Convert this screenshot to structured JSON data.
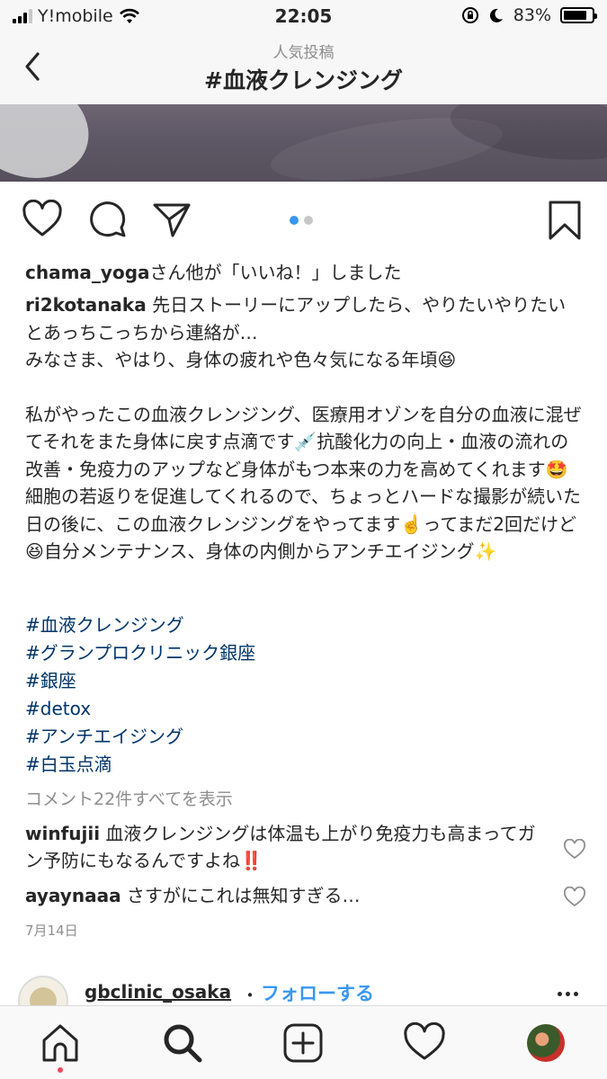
{
  "status_bar": {
    "carrier": "Y!mobile",
    "time": "22:05",
    "battery": "83%",
    "battery_level": 0.83,
    "icons": [
      "signal-icon",
      "wifi-icon",
      "orientation-lock-icon",
      "moon-icon",
      "battery-icon"
    ]
  },
  "nav": {
    "subtitle": "人気投稿",
    "title": "#血液クレンジング",
    "back_icon": "chevron-left-icon"
  },
  "post": {
    "carousel_count": 2,
    "carousel_active": 1,
    "likes_user": "chama_yoga",
    "likes_suffix": "さん他が「いいね！」しました",
    "caption_user": "ri2kotanaka",
    "caption_line1": " 先日ストーリーにアップしたら、やりたいやりたいとあっちこっちから連絡が…",
    "caption_line2": "みなさま、やはり、身体の疲れや色々気になる年頃😆",
    "caption_para2": "私がやったこの血液クレンジング、医療用オゾンを自分の血液に混ぜてそれをまた身体に戻す点滴です💉抗酸化力の向上・血液の流れの改善・免疫力のアップなど身体がもつ本来の力を高めてくれます🤩",
    "caption_para3": "細胞の若返りを促進してくれるので、ちょっとハードな撮影が続いた日の後に、この血液クレンジングをやってます☝️ってまだ2回だけど😆自分メンテナンス、身体の内側からアンチエイジング✨",
    "hashtags": [
      "#血液クレンジング",
      "#グランプロクリニック銀座",
      "#銀座",
      "#detox",
      "#アンチエイジング",
      "#白玉点滴"
    ],
    "view_comments": "コメント22件すべてを表示",
    "comments": [
      {
        "user": "winfujii",
        "text": " 血液クレンジングは体温も上がり免疫力も高まってガン予防にもなるんですよね‼️"
      },
      {
        "user": "ayaynaaa",
        "text": " さすがにこれは無知すぎる…"
      }
    ],
    "date": "7月14日"
  },
  "next_post": {
    "user": "gbclinic_osaka",
    "separator": "・",
    "follow": "フォローする"
  },
  "tabbar": {
    "tabs": [
      "home-icon",
      "search-icon",
      "add-post-icon",
      "activity-heart-icon",
      "profile-avatar"
    ],
    "active": "search-icon"
  },
  "colors": {
    "link": "#003569",
    "accent": "#3897f0",
    "muted": "#8e8e8e",
    "notification": "#ed4956"
  }
}
